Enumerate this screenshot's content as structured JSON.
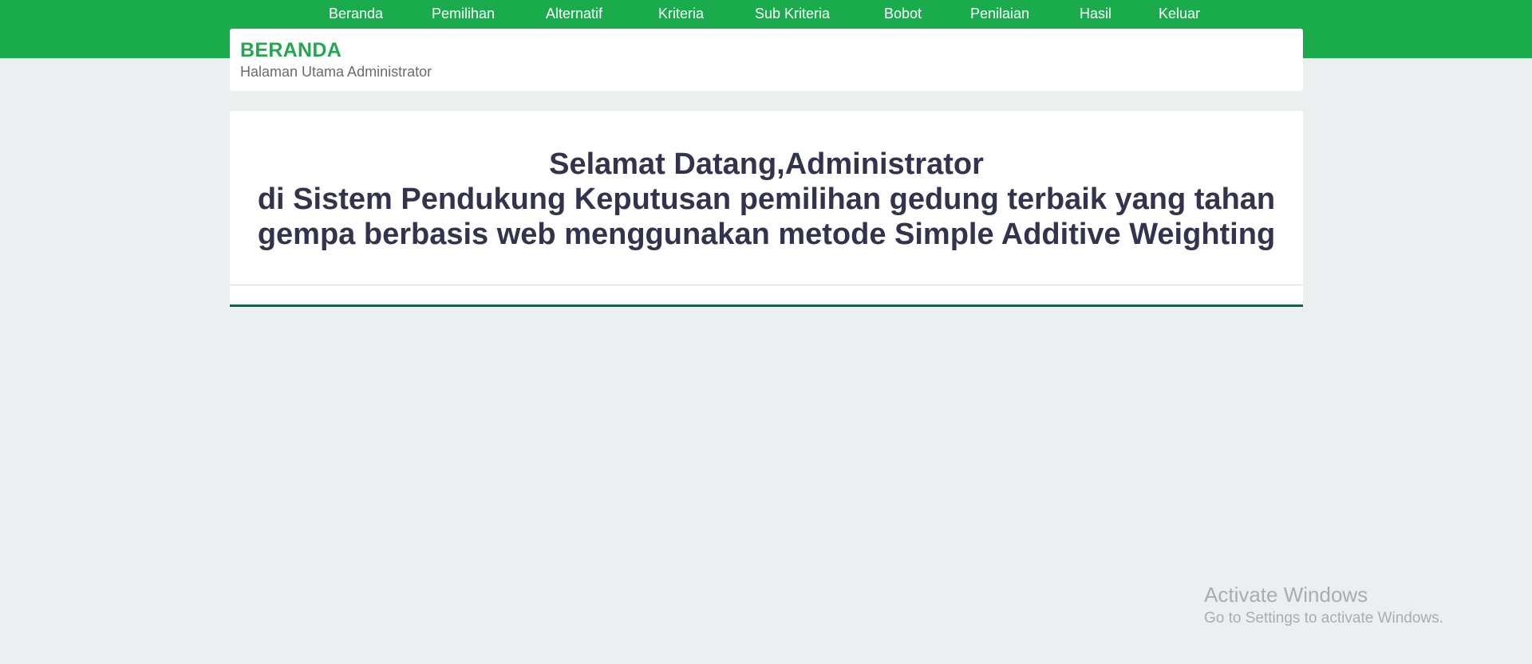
{
  "nav": {
    "items": [
      "Beranda",
      "Pemilihan",
      "Alternatif",
      "Kriteria",
      "Sub Kriteria",
      "Bobot",
      "Penilaian",
      "Hasil",
      "Keluar"
    ]
  },
  "header": {
    "title": "BERANDA",
    "subtitle": "Halaman Utama Administrator"
  },
  "welcome": {
    "line1": "Selamat Datang,Administrator",
    "line2": "di Sistem Pendukung Keputusan pemilihan gedung terbaik yang tahan",
    "line3": "gempa berbasis web menggunakan metode Simple Additive Weighting"
  },
  "watermark": {
    "title": "Activate Windows",
    "subtitle": "Go to Settings to activate Windows."
  },
  "colors": {
    "brand_green": "#1aab4d",
    "title_green": "#25a750",
    "text_dark": "#33334d",
    "background": "#ebeff0"
  }
}
